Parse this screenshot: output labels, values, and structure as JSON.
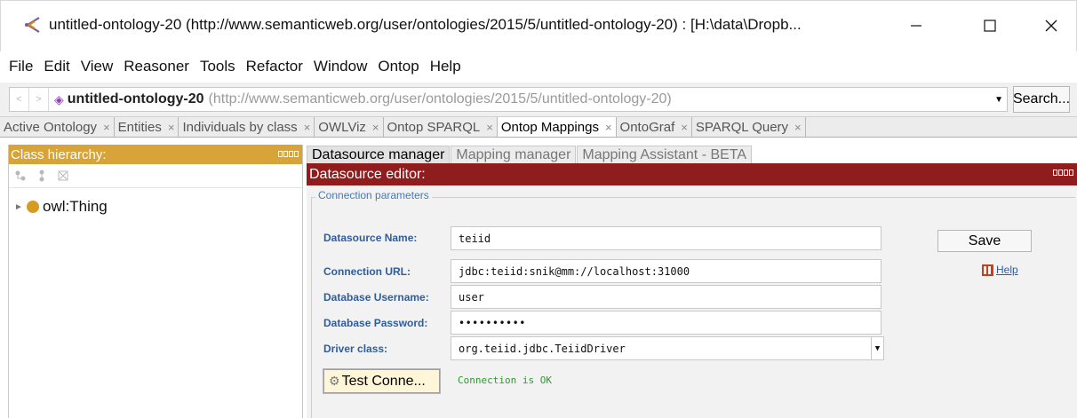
{
  "window": {
    "title": "untitled-ontology-20 (http://www.semanticweb.org/user/ontologies/2015/5/untitled-ontology-20)  : [H:\\data\\Dropb...",
    "controls": {
      "minimize": "—",
      "maximize": "☐",
      "close": "✕"
    }
  },
  "menu": [
    "File",
    "Edit",
    "View",
    "Reasoner",
    "Tools",
    "Refactor",
    "Window",
    "Ontop",
    "Help"
  ],
  "address": {
    "back": "<",
    "forward": ">",
    "ontology_name": "untitled-ontology-20",
    "ontology_iri": "(http://www.semanticweb.org/user/ontologies/2015/5/untitled-ontology-20)",
    "search_label": "Search..."
  },
  "tabs": [
    {
      "label": "Active Ontology",
      "active": false
    },
    {
      "label": "Entities",
      "active": false
    },
    {
      "label": "Individuals by class",
      "active": false
    },
    {
      "label": "OWLViz",
      "active": false
    },
    {
      "label": "Ontop SPARQL",
      "active": false
    },
    {
      "label": "Ontop Mappings",
      "active": true
    },
    {
      "label": "OntoGraf",
      "active": false
    },
    {
      "label": "SPARQL Query",
      "active": false
    }
  ],
  "tab_close_glyph": "×",
  "class_hierarchy": {
    "title": "Class hierarchy:",
    "tree": [
      {
        "label": "owl:Thing",
        "expander": "►"
      }
    ]
  },
  "subtabs": [
    {
      "label": "Datasource manager",
      "active": true
    },
    {
      "label": "Mapping manager",
      "active": false
    },
    {
      "label": "Mapping Assistant - BETA",
      "active": false
    }
  ],
  "editor": {
    "title": "Datasource editor:",
    "group_title": "Connection parameters",
    "fields": {
      "name": {
        "label": "Datasource Name:",
        "value": "teiid"
      },
      "url": {
        "label": "Connection URL:",
        "value": "jdbc:teiid:snik@mm://localhost:31000"
      },
      "username": {
        "label": "Database Username:",
        "value": "user"
      },
      "password": {
        "label": "Database Password:",
        "value": "••••••••••"
      },
      "driver": {
        "label": "Driver class:",
        "value": "org.teiid.jdbc.TeiidDriver"
      }
    },
    "save_label": "Save",
    "help_label": "Help",
    "test_button_label": "Test Conne...",
    "status_text": "Connection is OK"
  },
  "colors": {
    "class_hierarchy_header": "#d8a339",
    "editor_header": "#8f1d1d",
    "field_label": "#2f5d9c",
    "status_ok": "#2b9b2b"
  }
}
